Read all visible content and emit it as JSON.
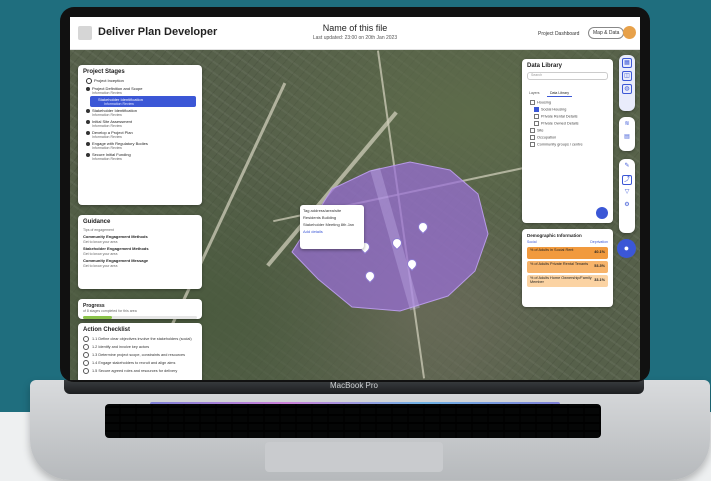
{
  "laptop": {
    "model_label": "MacBook Pro"
  },
  "header": {
    "app_name": "Deliver Plan Developer",
    "file_title": "Name of this file",
    "file_subtitle": "Last updated: 23:00 on 20th Jan 2023",
    "dashboard_link": "Project Dashboard",
    "map_data_button": "Map & Data"
  },
  "stages_panel": {
    "title": "Project Stages",
    "items": [
      {
        "label": "Project Inception",
        "meta": ""
      },
      {
        "label": "Project Definition and Scope",
        "meta": "Information   Review"
      },
      {
        "label": "Stakeholder Identification",
        "meta": "Information   Review"
      },
      {
        "label": "Stakeholder Identification",
        "meta": "Information   Review"
      },
      {
        "label": "Initial Site Assessment",
        "meta": "Information   Review"
      },
      {
        "label": "Develop a Project Plan",
        "meta": "Information   Review"
      },
      {
        "label": "Engage with Regulatory Bodies",
        "meta": "Information   Review"
      },
      {
        "label": "Secure Initial Funding",
        "meta": "Information   Review"
      }
    ]
  },
  "guidance": {
    "title": "Guidance",
    "subtitle": "Tips of engagement",
    "items": [
      {
        "title": "Community Engagement Methods",
        "sub": "Get to know your area"
      },
      {
        "title": "Stakeholder Engagement Methods",
        "sub": "Get to know your area"
      },
      {
        "title": "Community Engagement Message",
        "sub": "Get to know your area"
      }
    ]
  },
  "progress": {
    "title": "Progress",
    "caption": "of 8 stages completed for this area",
    "value": 0.25
  },
  "checklist": {
    "title": "Action Checklist",
    "items": [
      "1.1 Define clear objectives involve the stakeholders (social)",
      "1.2 Identify and involve key actors",
      "1.3 Determine project scope, constraints and resources",
      "1.4 Engage stakeholders to recruit and align aims",
      "1.5 Secure agreed roles and resources for delivery"
    ]
  },
  "data_library": {
    "title": "Data Library",
    "search_placeholder": "Search",
    "tabs": [
      "Layers",
      "Data Library"
    ],
    "groups": [
      {
        "label": "Housing",
        "checked": false
      },
      {
        "label": "Social Housing",
        "checked": true
      },
      {
        "label": "Private Rental Details",
        "checked": false
      },
      {
        "label": "Private Owned Details",
        "checked": false
      },
      {
        "label": "Site",
        "checked": false
      },
      {
        "label": "Occupation",
        "checked": false
      },
      {
        "label": "Community groups / centre",
        "checked": false
      }
    ]
  },
  "demographics": {
    "title": "Demographic Information",
    "col_left": "Social",
    "col_right": "Deprivation",
    "rows": [
      {
        "label": "% of Adults in Social Rent",
        "value": "40.1%",
        "color": "#f19a3e"
      },
      {
        "label": "% of Adults Private Rental Tenants",
        "value": "53.3%",
        "color": "#f7b46b"
      },
      {
        "label": "% of Adults Home Ownership/Family Member",
        "value": "33.1%",
        "color": "#fbd3a3"
      }
    ]
  },
  "map_tooltip": {
    "lines": [
      "Tag address/area/site",
      "Residents Building",
      "Stakeholder Meeting 8th Jan",
      "Add details"
    ]
  },
  "toolbar": {
    "icons": [
      "map-layer-icon",
      "satellite-icon",
      "globe-icon",
      "layers-icon",
      "clipboard-icon",
      "pencil-icon",
      "route-icon",
      "filter-icon",
      "settings-icon",
      "pin-icon"
    ]
  },
  "colors": {
    "accent": "#3b57d6",
    "polygon": "#9a6fd8",
    "orange": "#f19a3e"
  }
}
